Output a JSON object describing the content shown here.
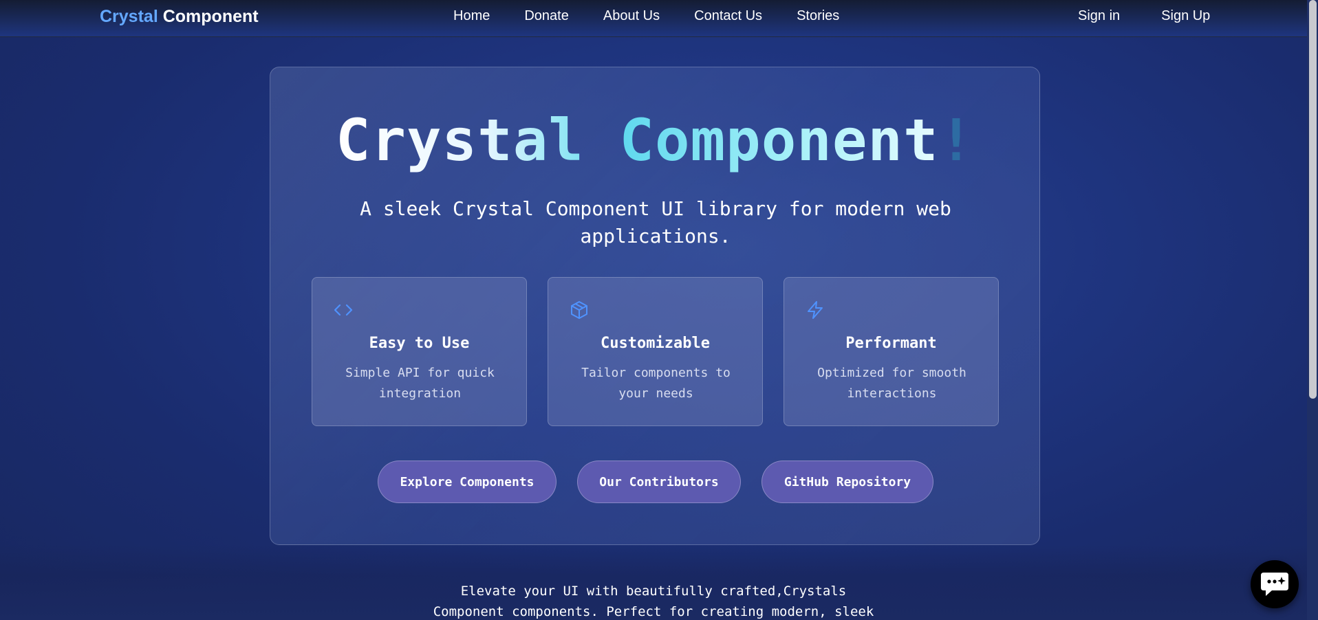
{
  "nav": {
    "brand_part1": "Crystal",
    "brand_part2": "Component",
    "links": [
      "Home",
      "Donate",
      "About Us",
      "Contact Us",
      "Stories"
    ],
    "sign_in": "Sign in",
    "sign_up": "Sign Up"
  },
  "hero": {
    "title_word1": "Crystal",
    "title_word2": "Component",
    "title_mark": "!",
    "subtitle": "A sleek Crystal Component UI library for modern web applications."
  },
  "features": [
    {
      "icon": "code-icon",
      "title": "Easy to Use",
      "description": "Simple API for quick integration"
    },
    {
      "icon": "box-icon",
      "title": "Customizable",
      "description": "Tailor components to your needs"
    },
    {
      "icon": "lightning-icon",
      "title": "Performant",
      "description": "Optimized for smooth interactions"
    }
  ],
  "cta": {
    "explore": "Explore Components",
    "contributors": "Our Contributors",
    "github": "GitHub Repository"
  },
  "tagline": {
    "line1": "Elevate your UI with beautifully crafted,Crystals",
    "line2": "Component components. Perfect for creating modern, sleek"
  },
  "colors": {
    "brand_accent": "#64a8ff",
    "icon_accent": "#4f93ff",
    "button_fill": "#5d5ab0",
    "title_gradient": "#5fd8ee"
  }
}
